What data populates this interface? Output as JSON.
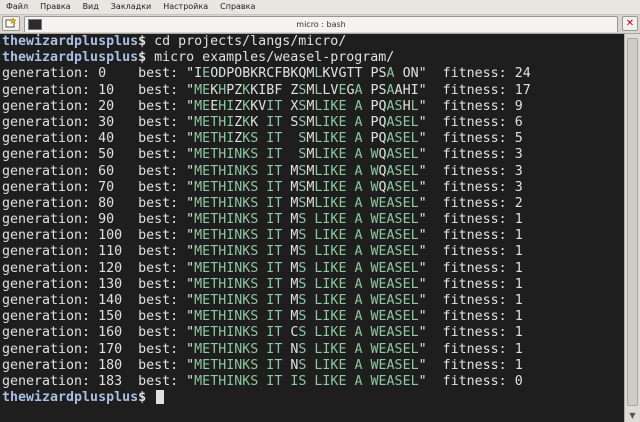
{
  "menu": [
    "Файл",
    "Правка",
    "Вид",
    "Закладки",
    "Настройка",
    "Справка"
  ],
  "tab": {
    "title": "micro : bash"
  },
  "terminal": {
    "user": "thewizardplusplus",
    "prompt_symbol": "$",
    "cmd1": " cd projects/langs/micro/",
    "cmd2": " micro examples/weasel-program/",
    "rows": [
      {
        "gen": "0",
        "best": "IEODPOBKRCFBKQMLKVGTT PSA ON",
        "fitness": "24"
      },
      {
        "gen": "10",
        "best": "MEKHPZKKIBF ZSMLLVEGA PSAAHI",
        "fitness": "17"
      },
      {
        "gen": "20",
        "best": "MEEHIZKKVIT XSMLIKE A PQASHL",
        "fitness": "9"
      },
      {
        "gen": "30",
        "best": "METHIZKK IT SSMLIKE A PQASEL",
        "fitness": "6"
      },
      {
        "gen": "40",
        "best": "METHIZKS IT  SMLIKE A PQASEL",
        "fitness": "5"
      },
      {
        "gen": "50",
        "best": "METHINKS IT  SMLIKE A WQASEL",
        "fitness": "3"
      },
      {
        "gen": "60",
        "best": "METHINKS IT MSMLIKE A WQASEL",
        "fitness": "3"
      },
      {
        "gen": "70",
        "best": "METHINKS IT MSMLIKE A WQASEL",
        "fitness": "3"
      },
      {
        "gen": "80",
        "best": "METHINKS IT MSMLIKE A WEASEL",
        "fitness": "2"
      },
      {
        "gen": "90",
        "best": "METHINKS IT MS LIKE A WEASEL",
        "fitness": "1"
      },
      {
        "gen": "100",
        "best": "METHINKS IT MS LIKE A WEASEL",
        "fitness": "1"
      },
      {
        "gen": "110",
        "best": "METHINKS IT MS LIKE A WEASEL",
        "fitness": "1"
      },
      {
        "gen": "120",
        "best": "METHINKS IT MS LIKE A WEASEL",
        "fitness": "1"
      },
      {
        "gen": "130",
        "best": "METHINKS IT MS LIKE A WEASEL",
        "fitness": "1"
      },
      {
        "gen": "140",
        "best": "METHINKS IT MS LIKE A WEASEL",
        "fitness": "1"
      },
      {
        "gen": "150",
        "best": "METHINKS IT MS LIKE A WEASEL",
        "fitness": "1"
      },
      {
        "gen": "160",
        "best": "METHINKS IT CS LIKE A WEASEL",
        "fitness": "1"
      },
      {
        "gen": "170",
        "best": "METHINKS IT NS LIKE A WEASEL",
        "fitness": "1"
      },
      {
        "gen": "180",
        "best": "METHINKS IT NS LIKE A WEASEL",
        "fitness": "1"
      },
      {
        "gen": "183",
        "best": "METHINKS IT IS LIKE A WEASEL",
        "fitness": "0"
      }
    ]
  }
}
